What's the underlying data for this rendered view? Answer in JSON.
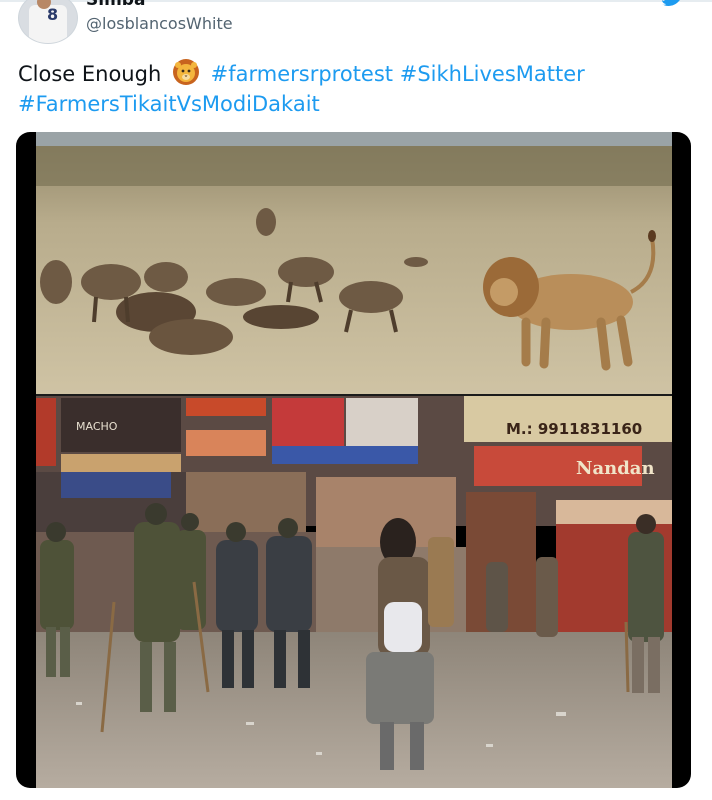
{
  "tweet": {
    "display_name": "Simba",
    "handle": "@losblancosWhite",
    "text_prefix": "Close Enough",
    "emoji": "lion-face",
    "hashtags": [
      "#farmersrprotest",
      "#SikhLivesMatter",
      "#FarmersTikaitVsModiDakait"
    ]
  },
  "avatar": {
    "jersey_number": "8"
  },
  "signs": {
    "phone": "M.: 9911831160",
    "shop": "Nandan",
    "banner_left": "MACHO"
  },
  "colors": {
    "link": "#1d9bf0",
    "text": "#0f1419",
    "muted": "#536471"
  },
  "icons": {
    "brand": "bird-icon"
  }
}
